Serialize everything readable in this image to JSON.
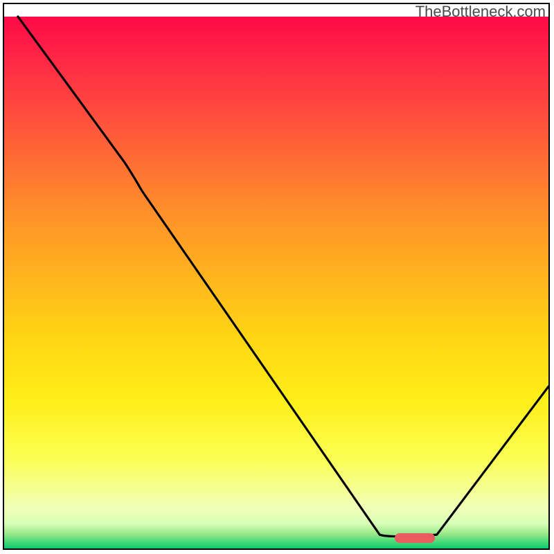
{
  "watermark": "TheBottleneck.com",
  "pill": {
    "x_pct": 75,
    "y_pct": 98,
    "color": "#e95d60"
  },
  "chart_data": {
    "type": "line",
    "title": "",
    "xlabel": "",
    "ylabel": "",
    "xlim": [
      0,
      100
    ],
    "ylim": [
      0,
      100
    ],
    "legend": false,
    "grid": false,
    "series": [
      {
        "name": "curve",
        "x": [
          3,
          22,
          70,
          80,
          100
        ],
        "y": [
          100,
          71,
          2,
          2,
          30
        ]
      }
    ],
    "gradient_stops": [
      {
        "pct": 0,
        "color": "#ff0a46"
      },
      {
        "pct": 50,
        "color": "#ffc81a"
      },
      {
        "pct": 85,
        "color": "#f7ff70"
      },
      {
        "pct": 100,
        "color": "#00c46b"
      }
    ]
  }
}
